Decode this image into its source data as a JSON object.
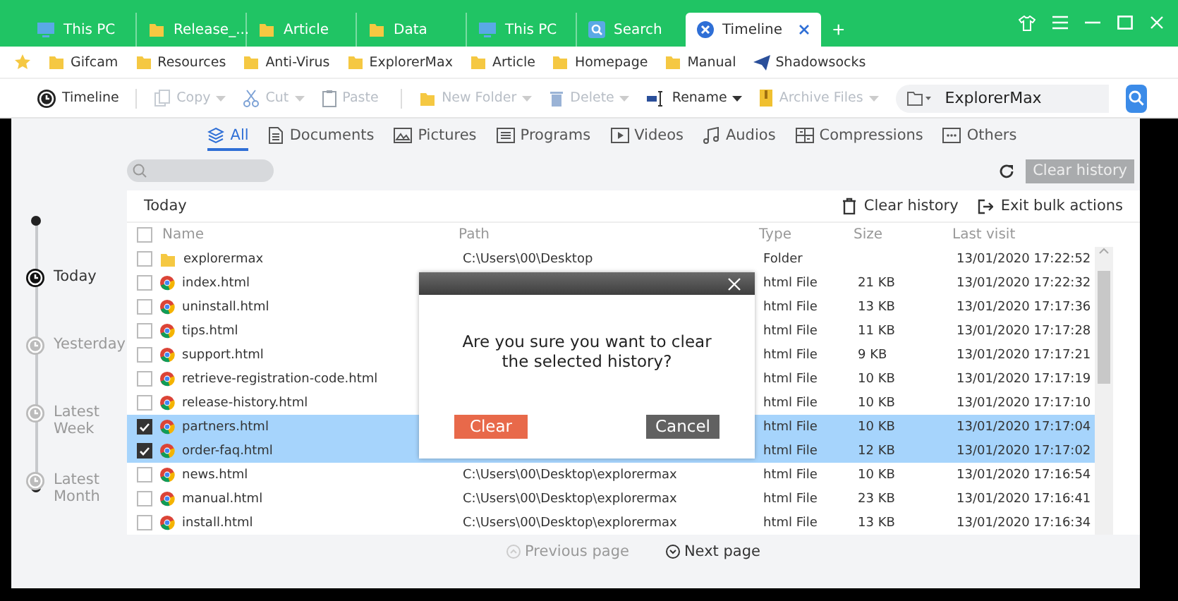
{
  "tabs": [
    {
      "label": "This PC",
      "kind": "pc",
      "selected": false
    },
    {
      "label": "Release_...",
      "kind": "folder",
      "selected": false
    },
    {
      "label": "Article",
      "kind": "folder",
      "selected": false
    },
    {
      "label": "Data",
      "kind": "folder",
      "selected": false
    },
    {
      "label": "This PC",
      "kind": "pc",
      "selected": false
    },
    {
      "label": "Search",
      "kind": "search",
      "selected": false
    },
    {
      "label": "Timeline",
      "kind": "timeline",
      "selected": true
    }
  ],
  "new_tab": "+",
  "bookmarks": [
    {
      "label": "Gifcam",
      "kind": "folder"
    },
    {
      "label": "Resources",
      "kind": "folder"
    },
    {
      "label": "Anti-Virus",
      "kind": "folder"
    },
    {
      "label": "ExplorerMax",
      "kind": "folder"
    },
    {
      "label": "Article",
      "kind": "folder"
    },
    {
      "label": "Homepage",
      "kind": "folder"
    },
    {
      "label": "Manual",
      "kind": "folder"
    },
    {
      "label": "Shadowsocks",
      "kind": "plane"
    }
  ],
  "toolbar": {
    "timeline": "Timeline",
    "buttons": [
      {
        "label": "Copy",
        "kind": "copy",
        "disabled": true,
        "dropdown": true
      },
      {
        "label": "Cut",
        "kind": "cut",
        "disabled": true,
        "dropdown": true
      },
      {
        "label": "Paste",
        "kind": "paste",
        "disabled": true,
        "dropdown": false
      },
      {
        "label": "New Folder",
        "kind": "folder",
        "disabled": true,
        "dropdown": true
      },
      {
        "label": "Delete",
        "kind": "delete",
        "disabled": true,
        "dropdown": true
      },
      {
        "label": "Rename",
        "kind": "rename",
        "disabled": false,
        "dropdown": true
      },
      {
        "label": "Archive Files",
        "kind": "archive",
        "disabled": true,
        "dropdown": true
      }
    ],
    "address": "ExplorerMax"
  },
  "categories": [
    {
      "label": "All",
      "kind": "all",
      "selected": true
    },
    {
      "label": "Documents",
      "kind": "doc",
      "selected": false
    },
    {
      "label": "Pictures",
      "kind": "pic",
      "selected": false
    },
    {
      "label": "Programs",
      "kind": "prog",
      "selected": false
    },
    {
      "label": "Videos",
      "kind": "video",
      "selected": false
    },
    {
      "label": "Audios",
      "kind": "audio",
      "selected": false
    },
    {
      "label": "Compressions",
      "kind": "zip",
      "selected": false
    },
    {
      "label": "Others",
      "kind": "other",
      "selected": false
    }
  ],
  "clear_history_button": "Clear history",
  "timeline": [
    {
      "label": "Today",
      "selected": true
    },
    {
      "label": "Yesterday",
      "selected": false
    },
    {
      "label": "Latest Week",
      "selected": false
    },
    {
      "label": "Latest Month",
      "selected": false
    }
  ],
  "list": {
    "title": "Today",
    "actions": [
      {
        "label": "Clear history",
        "kind": "trash"
      },
      {
        "label": "Exit bulk actions",
        "kind": "exit"
      }
    ],
    "all_checked": false,
    "columns": [
      "Name",
      "Path",
      "Type",
      "Size",
      "Last visit"
    ],
    "rows": [
      {
        "name": "explorermax",
        "kind": "folder",
        "path": "C:\\Users\\00\\Desktop",
        "type": "Folder",
        "last_visit": "13/01/2020 17:22:52",
        "checked": false
      },
      {
        "name": "index.html",
        "kind": "html",
        "type": "html File",
        "size": "21 KB",
        "last_visit": "13/01/2020 17:22:32",
        "checked": false
      },
      {
        "name": "uninstall.html",
        "kind": "html",
        "type": "html File",
        "size": "13 KB",
        "last_visit": "13/01/2020 17:17:36",
        "checked": false
      },
      {
        "name": "tips.html",
        "kind": "html",
        "type": "html File",
        "size": "11 KB",
        "last_visit": "13/01/2020 17:17:28",
        "checked": false
      },
      {
        "name": "support.html",
        "kind": "html",
        "type": "html File",
        "size": "9 KB",
        "last_visit": "13/01/2020 17:17:21",
        "checked": false
      },
      {
        "name": "retrieve-registration-code.html",
        "kind": "html",
        "type": "html File",
        "size": "10 KB",
        "last_visit": "13/01/2020 17:17:19",
        "checked": false
      },
      {
        "name": "release-history.html",
        "kind": "html",
        "type": "html File",
        "size": "10 KB",
        "last_visit": "13/01/2020 17:17:10",
        "checked": false
      },
      {
        "name": "partners.html",
        "kind": "html",
        "type": "html File",
        "size": "10 KB",
        "last_visit": "13/01/2020 17:17:04",
        "checked": true
      },
      {
        "name": "order-faq.html",
        "kind": "html",
        "type": "html File",
        "size": "12 KB",
        "last_visit": "13/01/2020 17:17:02",
        "checked": true
      },
      {
        "name": "news.html",
        "kind": "html",
        "path": "C:\\Users\\00\\Desktop\\explorermax",
        "type": "html File",
        "size": "10 KB",
        "last_visit": "13/01/2020 17:16:54",
        "checked": false
      },
      {
        "name": "manual.html",
        "kind": "html",
        "path": "C:\\Users\\00\\Desktop\\explorermax",
        "type": "html File",
        "size": "23 KB",
        "last_visit": "13/01/2020 17:16:41",
        "checked": false
      },
      {
        "name": "install.html",
        "kind": "html",
        "path": "C:\\Users\\00\\Desktop\\explorermax",
        "type": "html File",
        "size": "13 KB",
        "last_visit": "13/01/2020 17:16:34",
        "checked": false
      }
    ]
  },
  "pagination": [
    {
      "label": "Previous page",
      "disabled": true
    },
    {
      "label": "Next page",
      "disabled": false
    }
  ],
  "dialog": {
    "message": "Are you sure you want to clear the selected history?",
    "buttons": [
      {
        "label": "Clear",
        "kind": "primary"
      },
      {
        "label": "Cancel",
        "kind": "secondary"
      }
    ]
  }
}
